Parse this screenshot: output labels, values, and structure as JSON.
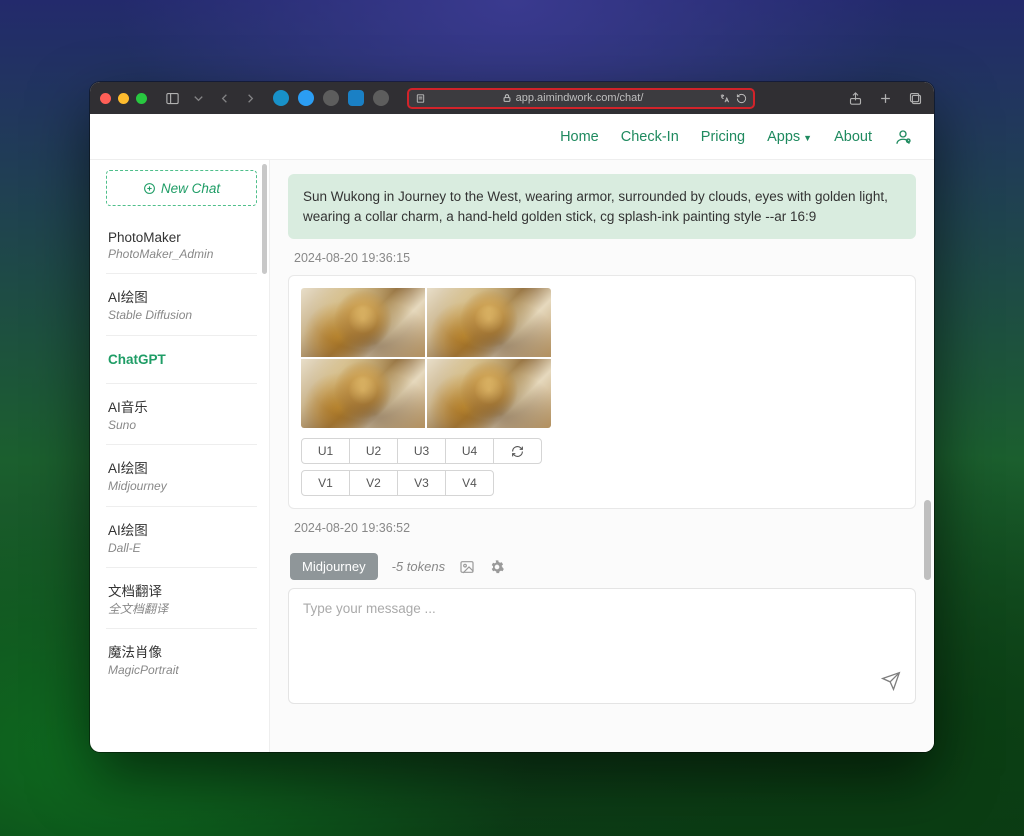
{
  "browser": {
    "url_display": "app.aimindwork.com/chat/"
  },
  "nav": {
    "home": "Home",
    "checkin": "Check-In",
    "pricing": "Pricing",
    "apps": "Apps",
    "about": "About"
  },
  "sidebar": {
    "new_chat": "New Chat",
    "items": [
      {
        "title": "PhotoMaker",
        "subtitle": "PhotoMaker_Admin"
      },
      {
        "title": "AI绘图",
        "subtitle": "Stable Diffusion"
      },
      {
        "title": "ChatGPT",
        "subtitle": ""
      },
      {
        "title": "AI音乐",
        "subtitle": "Suno"
      },
      {
        "title": "AI绘图",
        "subtitle": "Midjourney"
      },
      {
        "title": "AI绘图",
        "subtitle": "Dall-E"
      },
      {
        "title": "文档翻译",
        "subtitle": "全文档翻译"
      },
      {
        "title": "魔法肖像",
        "subtitle": "MagicPortrait"
      }
    ]
  },
  "chat": {
    "prompt": "Sun Wukong in Journey to the West, wearing armor, surrounded by clouds, eyes with golden light, wearing a collar charm, a hand-held golden stick, cg splash-ink painting style --ar 16:9",
    "ts1": "2024-08-20 19:36:15",
    "ts2": "2024-08-20 19:36:52",
    "upscale": [
      "U1",
      "U2",
      "U3",
      "U4"
    ],
    "variation": [
      "V1",
      "V2",
      "V3",
      "V4"
    ]
  },
  "composer": {
    "badge": "Midjourney",
    "tokens": "-5 tokens",
    "placeholder": "Type your message ..."
  }
}
